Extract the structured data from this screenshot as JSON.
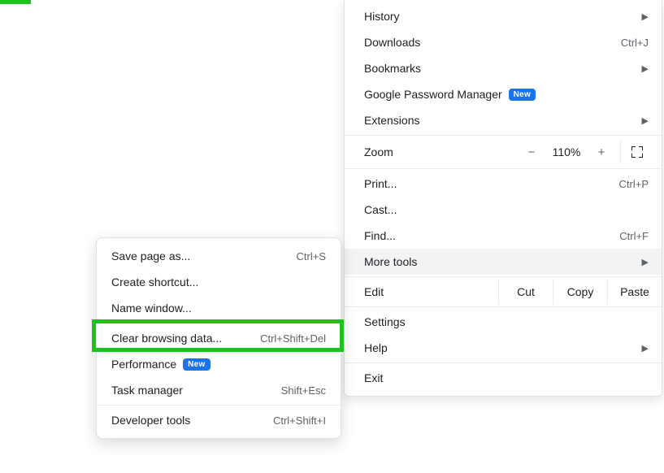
{
  "main_menu": {
    "history": {
      "label": "History"
    },
    "downloads": {
      "label": "Downloads",
      "shortcut": "Ctrl+J"
    },
    "bookmarks": {
      "label": "Bookmarks"
    },
    "gpm": {
      "label": "Google Password Manager",
      "badge": "New"
    },
    "extensions": {
      "label": "Extensions"
    },
    "zoom": {
      "label": "Zoom",
      "minus": "−",
      "value": "110%",
      "plus": "+"
    },
    "print": {
      "label": "Print...",
      "shortcut": "Ctrl+P"
    },
    "cast": {
      "label": "Cast..."
    },
    "find": {
      "label": "Find...",
      "shortcut": "Ctrl+F"
    },
    "more_tools": {
      "label": "More tools"
    },
    "edit": {
      "label": "Edit",
      "cut": "Cut",
      "copy": "Copy",
      "paste": "Paste"
    },
    "settings": {
      "label": "Settings"
    },
    "help": {
      "label": "Help"
    },
    "exit": {
      "label": "Exit"
    }
  },
  "sub_menu": {
    "save_page": {
      "label": "Save page as...",
      "shortcut": "Ctrl+S"
    },
    "create_shortcut": {
      "label": "Create shortcut..."
    },
    "name_window": {
      "label": "Name window..."
    },
    "clear_data": {
      "label": "Clear browsing data...",
      "shortcut": "Ctrl+Shift+Del"
    },
    "performance": {
      "label": "Performance",
      "badge": "New"
    },
    "task_manager": {
      "label": "Task manager",
      "shortcut": "Shift+Esc"
    },
    "dev_tools": {
      "label": "Developer tools",
      "shortcut": "Ctrl+Shift+I"
    }
  }
}
